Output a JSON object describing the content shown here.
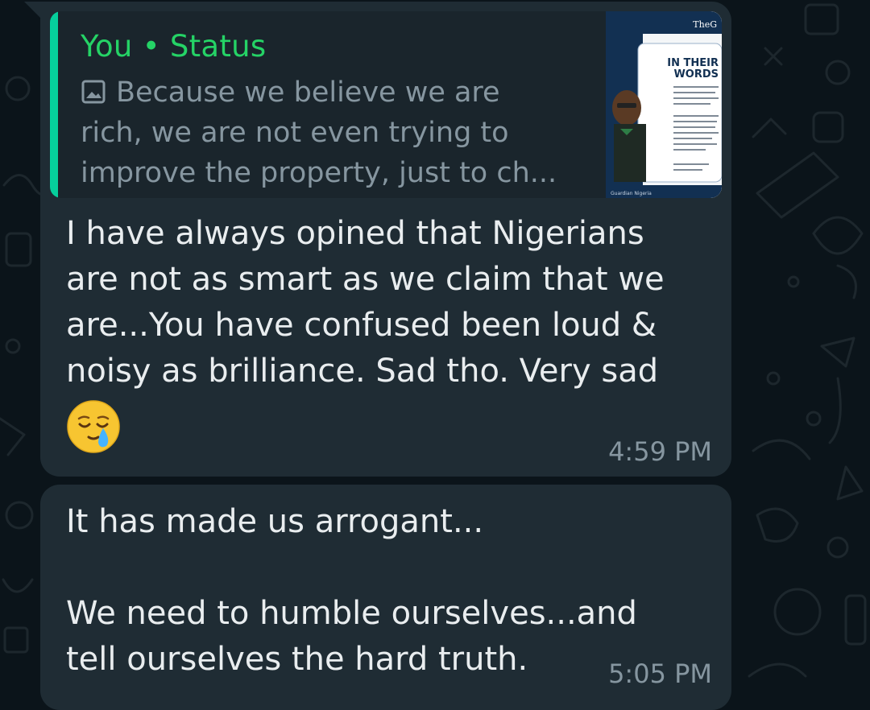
{
  "theme": {
    "background": "#0b141a",
    "bubble": "#1f2c34",
    "accent_green": "#25d366",
    "text_primary": "#e9edef",
    "text_secondary": "#8696a0"
  },
  "messages": [
    {
      "quote": {
        "author": "You",
        "separator": "•",
        "source": "Status",
        "media_icon": "photo-icon",
        "preview_lines": [
          "Because we believe we are",
          "rich, we are not even trying to",
          "improve the property, just to ch..."
        ],
        "thumbnail": {
          "brand": "TheG",
          "headline_1": "IN THEIR",
          "headline_2": "WORDS",
          "credit": "Guardian Nigeria"
        }
      },
      "lines": [
        "I have always opined that Nigerians",
        "are not as smart as we claim that we",
        "are...You have confused been loud &",
        "noisy as brilliance. Sad tho. Very sad"
      ],
      "emoji": "face-holding-back-tears-emoji",
      "time": "4:59 PM"
    },
    {
      "lines": [
        "It has made us arrogant...",
        "",
        "We need to humble ourselves...and",
        "tell ourselves the hard truth."
      ],
      "time": "5:05 PM"
    }
  ]
}
